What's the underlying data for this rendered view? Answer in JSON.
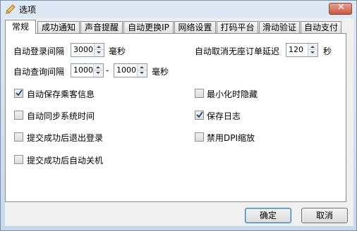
{
  "window": {
    "title": "选项"
  },
  "tabs": [
    {
      "label": "常规",
      "active": true
    },
    {
      "label": "成功通知"
    },
    {
      "label": "声音提醒"
    },
    {
      "label": "自动更换IP"
    },
    {
      "label": "网络设置"
    },
    {
      "label": "打码平台"
    },
    {
      "label": "滑动验证"
    },
    {
      "label": "自动支付"
    }
  ],
  "general": {
    "login_interval": {
      "label": "自动登录间隔",
      "value": "3000",
      "unit": "毫秒"
    },
    "cancel_delay": {
      "label": "自动取消无座订单延迟",
      "value": "120",
      "unit": "秒"
    },
    "query_interval": {
      "label": "自动查询间隔",
      "min": "1000",
      "sep": "-",
      "max": "1000",
      "unit": "毫秒"
    },
    "checkboxes": [
      {
        "label": "自动保存乘客信息",
        "checked": true
      },
      {
        "label": "最小化时隐藏",
        "checked": false
      },
      {
        "label": "自动同步系统时间",
        "checked": false
      },
      {
        "label": "保存日志",
        "checked": true
      },
      {
        "label": "提交成功后退出登录",
        "checked": false
      },
      {
        "label": "禁用DPI缩放",
        "checked": false
      },
      {
        "label": "提交成功后自动关机",
        "checked": false
      }
    ]
  },
  "buttons": {
    "ok": "确定",
    "cancel": "取消"
  },
  "icons": {
    "title": "pencil-icon",
    "close": "close-icon"
  }
}
